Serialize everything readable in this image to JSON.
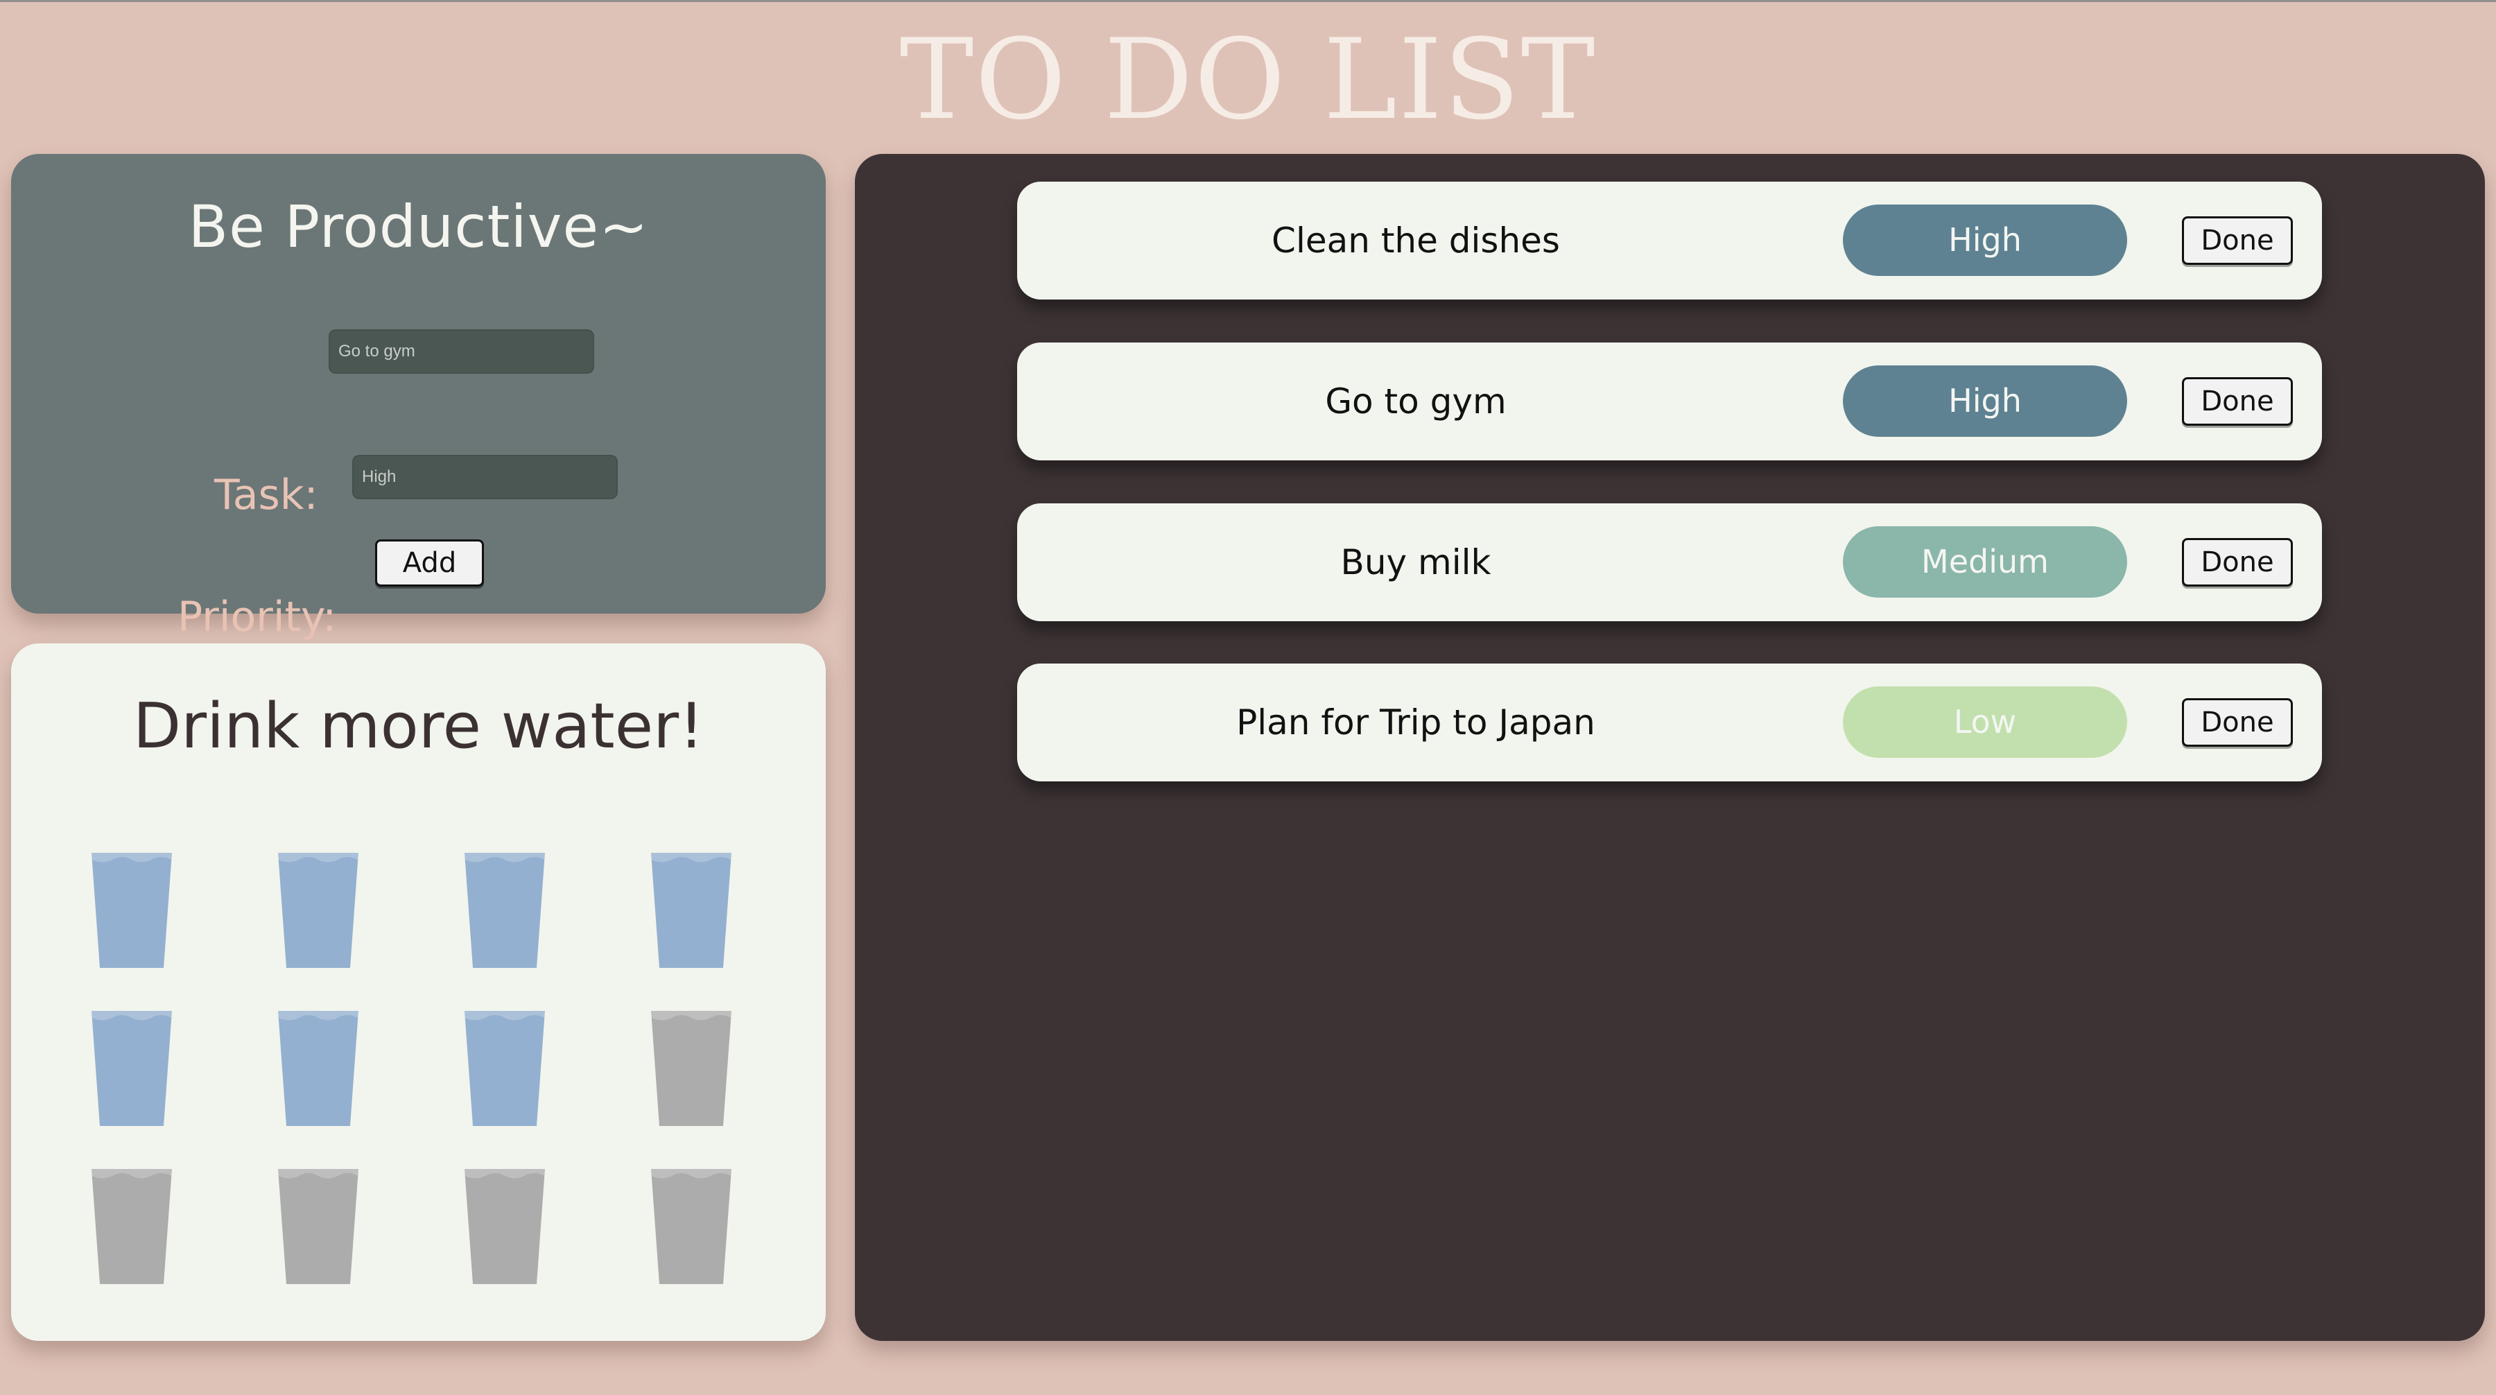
{
  "page": {
    "title": "TO DO LIST"
  },
  "form": {
    "title": "Be Productive~",
    "task_label": "Task:",
    "task_placeholder": "Go to gym",
    "priority_label": "Priority:",
    "priority_placeholder": "High",
    "add_label": "Add"
  },
  "water": {
    "title": "Drink more water!",
    "total_cups": 12,
    "filled_cups": 7,
    "filled_color": "#94b0d0",
    "empty_color": "#acacac"
  },
  "tasks": [
    {
      "name": "Clean the dishes",
      "priority": "High",
      "priority_color": "#5e8292",
      "done_label": "Done"
    },
    {
      "name": "Go to gym",
      "priority": "High",
      "priority_color": "#5e8292",
      "done_label": "Done"
    },
    {
      "name": "Buy milk",
      "priority": "Medium",
      "priority_color": "#8bb6aa",
      "done_label": "Done"
    },
    {
      "name": "Plan for Trip to Japan",
      "priority": "Low",
      "priority_color": "#c1e0ad",
      "done_label": "Done"
    }
  ],
  "colors": {
    "background": "#dfc2b7",
    "form_card": "#6b7677",
    "task_panel": "#3d3335",
    "card_light": "#f2f5ed"
  },
  "icons": {
    "cup": "water-cup-icon"
  }
}
